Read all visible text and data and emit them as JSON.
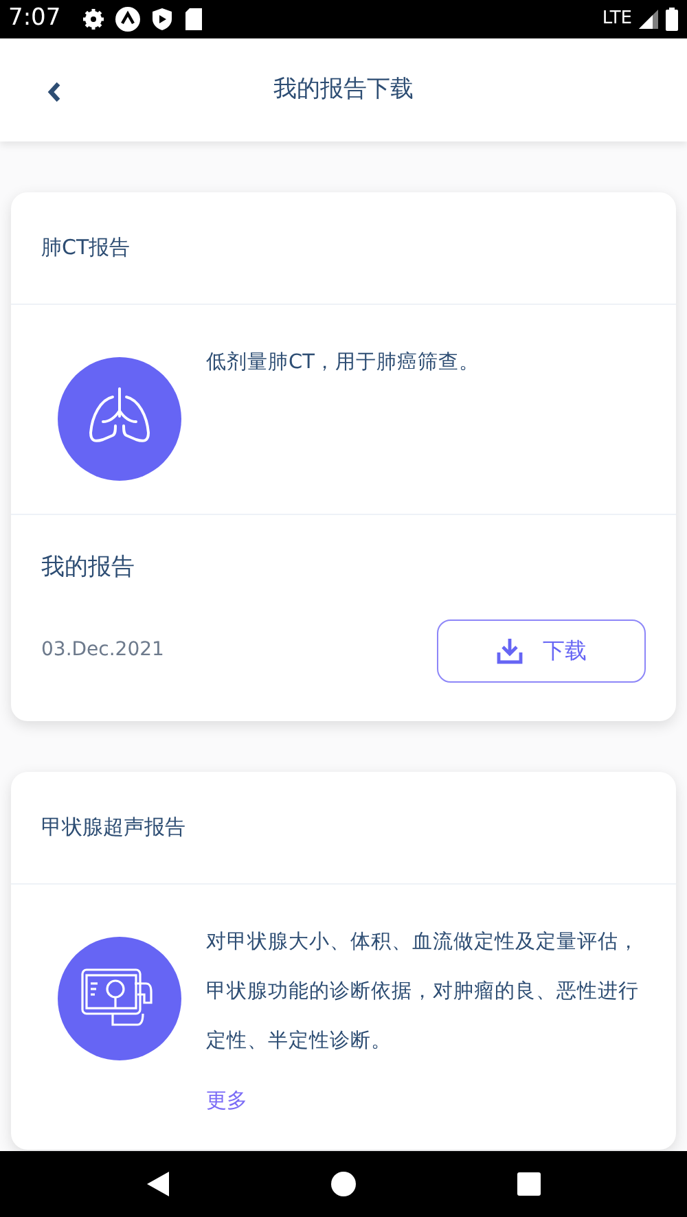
{
  "status_bar": {
    "time": "7:07",
    "network": "LTE"
  },
  "header": {
    "title": "我的报告下载"
  },
  "reports": [
    {
      "kind": "lung",
      "title": "肺CT报告",
      "description": "低剂量肺CT，用于肺癌筛查。",
      "download": {
        "label": "我的报告",
        "date": "03.Dec.2021",
        "button": "下载"
      }
    },
    {
      "kind": "thyroid",
      "title": "甲状腺超声报告",
      "description": "对甲状腺大小、体积、血流做定性及定量评估，甲状腺功能的诊断依据，对肿瘤的良、恶性进行定性、半定性诊断。",
      "more": "更多"
    }
  ]
}
